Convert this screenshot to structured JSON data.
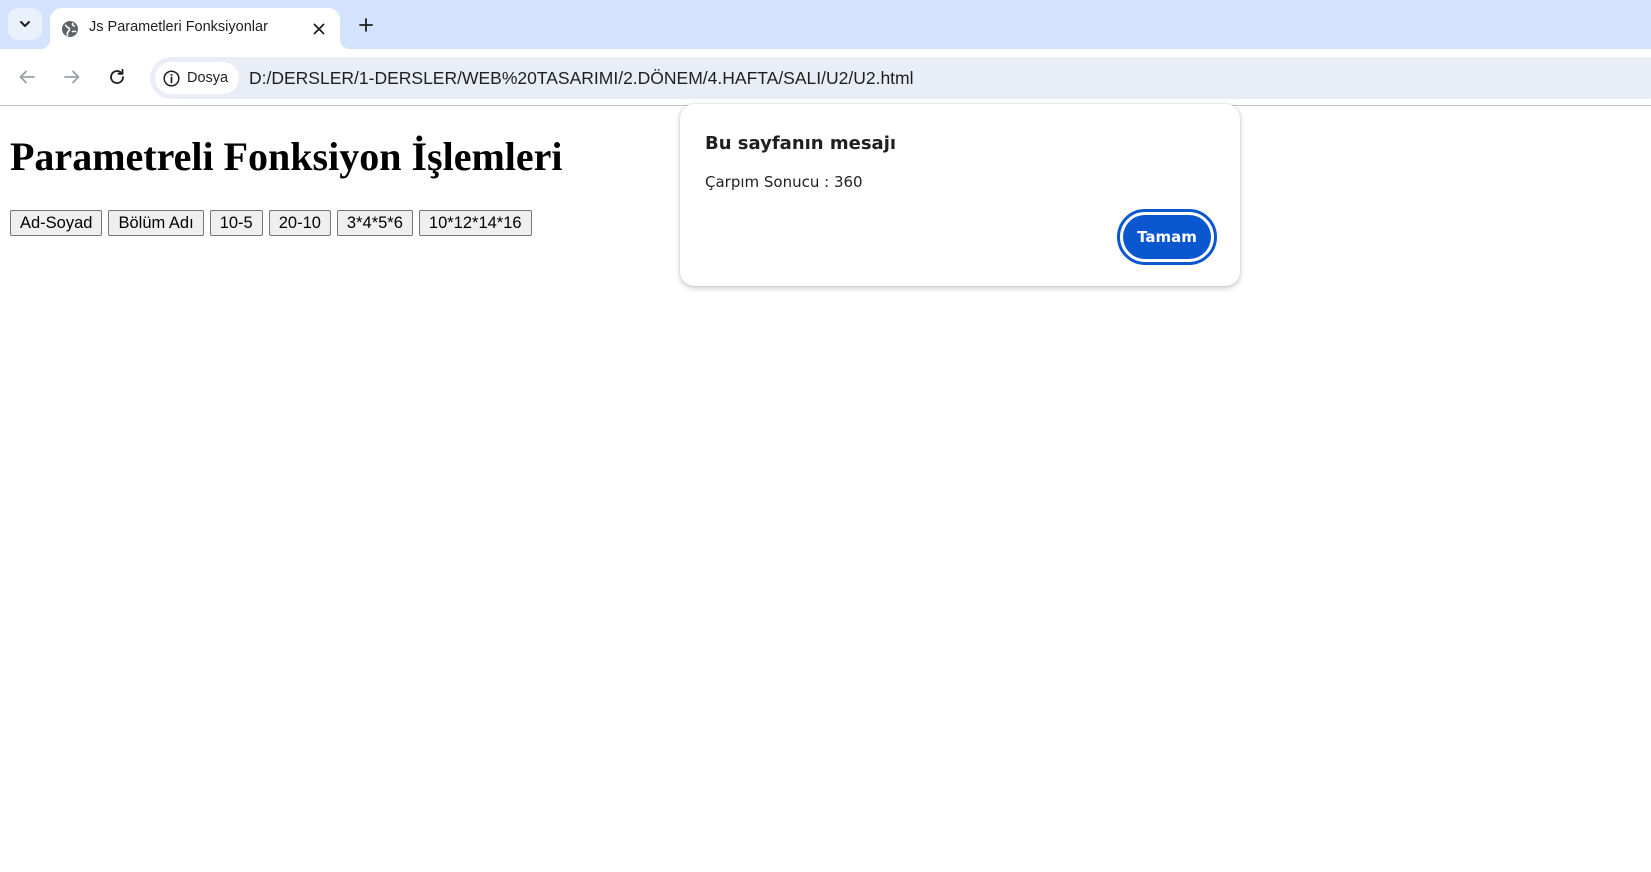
{
  "browser": {
    "tab": {
      "title": "Js Parametleri Fonksiyonlar"
    },
    "address_bar": {
      "security_chip_label": "Dosya",
      "url": "D:/DERSLER/1-DERSLER/WEB%20TASARIMI/2.DÖNEM/4.HAFTA/SALI/U2/U2.html"
    },
    "icons": [
      "tab-search-icon",
      "globe-icon",
      "close-icon",
      "plus-icon",
      "back-arrow-icon",
      "forward-arrow-icon",
      "reload-icon",
      "info-icon"
    ]
  },
  "page": {
    "heading": "Parametreli Fonksiyon İşlemleri",
    "buttons": [
      {
        "label": "Ad-Soyad"
      },
      {
        "label": "Bölüm Adı"
      },
      {
        "label": "10-5"
      },
      {
        "label": "20-10"
      },
      {
        "label": "3*4*5*6"
      },
      {
        "label": "10*12*14*16"
      }
    ]
  },
  "dialog": {
    "title": "Bu sayfanın mesajı",
    "message": "Çarpım Sonucu : 360",
    "ok_label": "Tamam"
  },
  "colors": {
    "tabstrip_bg": "#d3e3fd",
    "omnibox_bg": "#e8edf6",
    "dialog_button": "#0b57d0"
  }
}
